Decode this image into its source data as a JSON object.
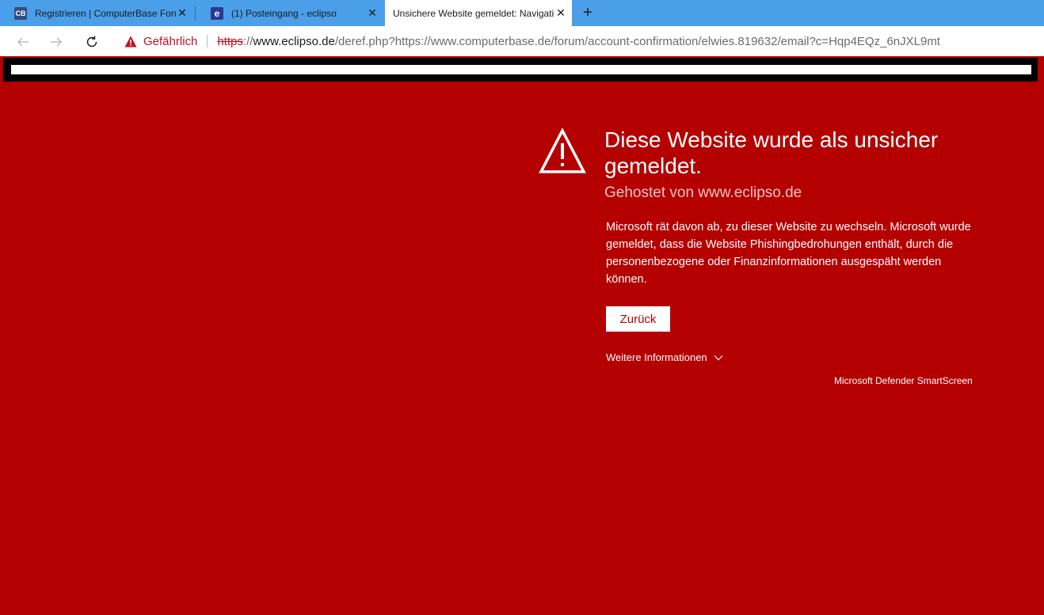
{
  "tabs": [
    {
      "label": "Registrieren | ComputerBase Forum",
      "favicon": "CB",
      "favicon_color": "#2f4f7f"
    },
    {
      "label": "(1) Posteingang - eclipso",
      "favicon": "e",
      "favicon_color": "#2b3a8f"
    },
    {
      "label": "Unsichere Website gemeldet: Navigation blockiert",
      "active": true
    }
  ],
  "address": {
    "security_label": "Gefährlich",
    "protocol": "https",
    "separator": "://",
    "host": "www.eclipso.de",
    "path": "/deref.php?https://www.computerbase.de/forum/account-confirmation/elwies.819632/email?c=Hqp4EQz_6nJXL9mt"
  },
  "warning": {
    "title": "Diese Website wurde als unsicher gemeldet.",
    "hosted": "Gehostet von www.eclipso.de",
    "body": "Microsoft rät davon ab, zu dieser Website zu wechseln. Microsoft wurde gemeldet, dass die Website Phishingbedrohungen enthält, durch die personenbezogene oder Finanzinformationen ausgespäht werden können.",
    "back_label": "Zurück",
    "more_info_label": "Weitere Informationen",
    "footer": "Microsoft Defender SmartScreen"
  },
  "colors": {
    "background": "#b50000",
    "tabbar": "#4a9fe8",
    "danger_text": "#c50f1f"
  }
}
